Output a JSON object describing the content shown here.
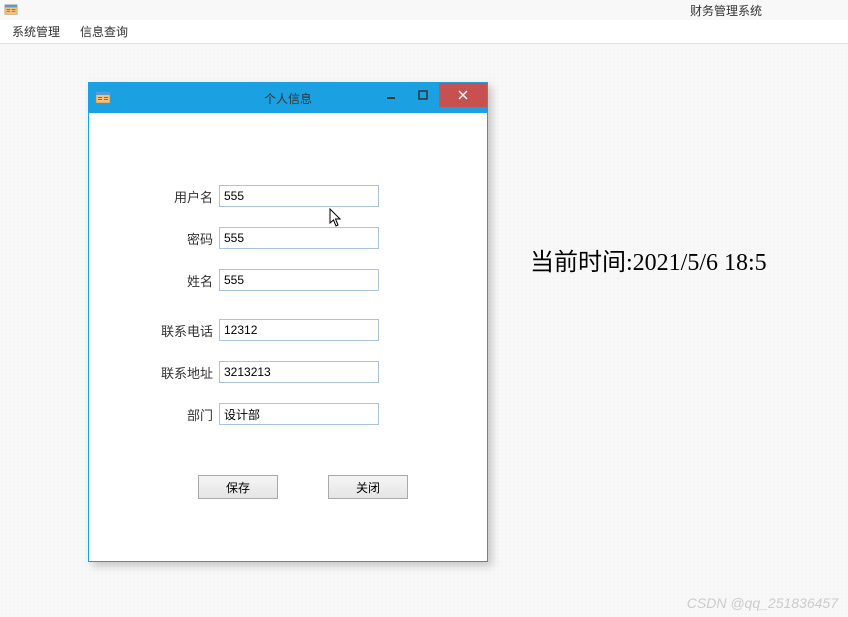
{
  "main_window": {
    "title": "财务管理系统"
  },
  "menubar": {
    "items": [
      "系统管理",
      "信息查询"
    ]
  },
  "clock": {
    "text": "当前时间:2021/5/6 18:5"
  },
  "dialog": {
    "title": "个人信息",
    "fields": {
      "username": {
        "label": "用户名",
        "value": "555"
      },
      "password": {
        "label": "密码",
        "value": "555"
      },
      "name": {
        "label": "姓名",
        "value": "555"
      },
      "phone": {
        "label": "联系电话",
        "value": "12312"
      },
      "address": {
        "label": "联系地址",
        "value": "3213213"
      },
      "department": {
        "label": "部门",
        "value": "设计部"
      }
    },
    "buttons": {
      "save": "保存",
      "close": "关闭"
    }
  },
  "watermark": "CSDN @qq_251836457"
}
